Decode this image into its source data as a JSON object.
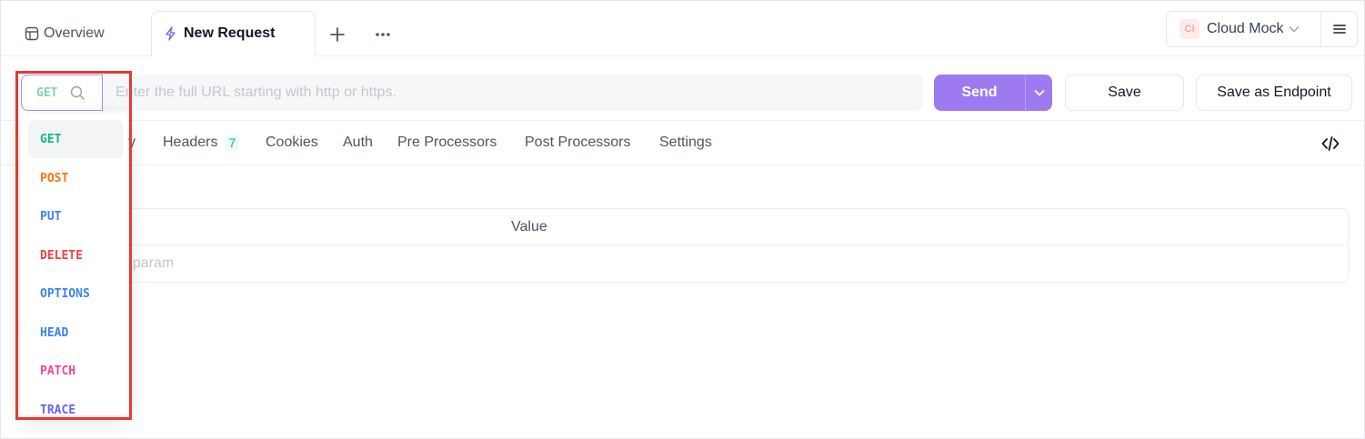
{
  "tabs": {
    "overview_label": "Overview",
    "active_label": "New Request"
  },
  "environment": {
    "badge": "CI",
    "label": "Cloud Mock"
  },
  "url_bar": {
    "method": "GET",
    "placeholder": "Enter the full URL starting with http or https.",
    "send_label": "Send",
    "save_label": "Save",
    "save_endpoint_label": "Save as Endpoint"
  },
  "subtabs": {
    "params_fragment": "y",
    "headers": "Headers",
    "headers_count": "7",
    "cookies": "Cookies",
    "auth": "Auth",
    "pre_processors": "Pre Processors",
    "post_processors": "Post Processors",
    "settings": "Settings"
  },
  "params_table": {
    "value_header": "Value",
    "add_placeholder": "ew param"
  },
  "method_dropdown": {
    "items": [
      {
        "label": "GET",
        "color": "#10b981"
      },
      {
        "label": "POST",
        "color": "#f97316"
      },
      {
        "label": "PUT",
        "color": "#3b82f6"
      },
      {
        "label": "DELETE",
        "color": "#ef4444"
      },
      {
        "label": "OPTIONS",
        "color": "#3b82f6"
      },
      {
        "label": "HEAD",
        "color": "#3b82f6"
      },
      {
        "label": "PATCH",
        "color": "#ec4899"
      },
      {
        "label": "TRACE",
        "color": "#6366f1"
      }
    ]
  },
  "colors": {
    "accent": "#9d7af0",
    "highlight": "#e53935"
  }
}
